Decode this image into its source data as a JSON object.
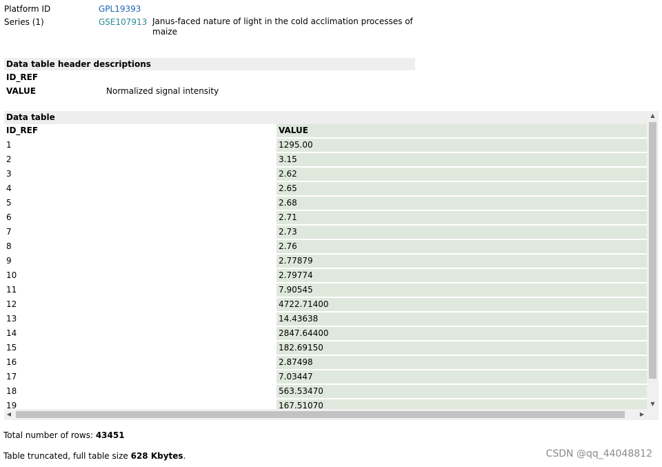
{
  "meta": {
    "platform_label": "Platform ID",
    "platform_id": "GPL19393",
    "series_label": "Series (1)",
    "series_id": "GSE107913",
    "series_desc": "Janus-faced nature of light in the cold acclimation processes of maize"
  },
  "header_desc": {
    "title": "Data table header descriptions",
    "rows": [
      {
        "key": "ID_REF",
        "value": ""
      },
      {
        "key": "VALUE",
        "value": "Normalized signal intensity"
      }
    ]
  },
  "data_table": {
    "title": "Data table",
    "columns": [
      "ID_REF",
      "VALUE"
    ],
    "rows": [
      [
        "1",
        "1295.00"
      ],
      [
        "2",
        "3.15"
      ],
      [
        "3",
        "2.62"
      ],
      [
        "4",
        "2.65"
      ],
      [
        "5",
        "2.68"
      ],
      [
        "6",
        "2.71"
      ],
      [
        "7",
        "2.73"
      ],
      [
        "8",
        "2.76"
      ],
      [
        "9",
        "2.77879"
      ],
      [
        "10",
        "2.79774"
      ],
      [
        "11",
        "7.90545"
      ],
      [
        "12",
        "4722.71400"
      ],
      [
        "13",
        "14.43638"
      ],
      [
        "14",
        "2847.64400"
      ],
      [
        "15",
        "182.69150"
      ],
      [
        "16",
        "2.87498"
      ],
      [
        "17",
        "7.03447"
      ],
      [
        "18",
        "563.53470"
      ],
      [
        "19",
        "167.51070"
      ]
    ]
  },
  "footer": {
    "total_rows_label": "Total number of rows: ",
    "total_rows_value": "43451",
    "truncated_label": "Table truncated, full table size ",
    "truncated_value": "628 Kbytes",
    "truncated_suffix": "."
  },
  "watermark": "CSDN @qq_44048812",
  "colors": {
    "link": "#1b63b4",
    "value_column_bg": "#dfe8dc",
    "section_header_bg": "#eeeeee"
  }
}
